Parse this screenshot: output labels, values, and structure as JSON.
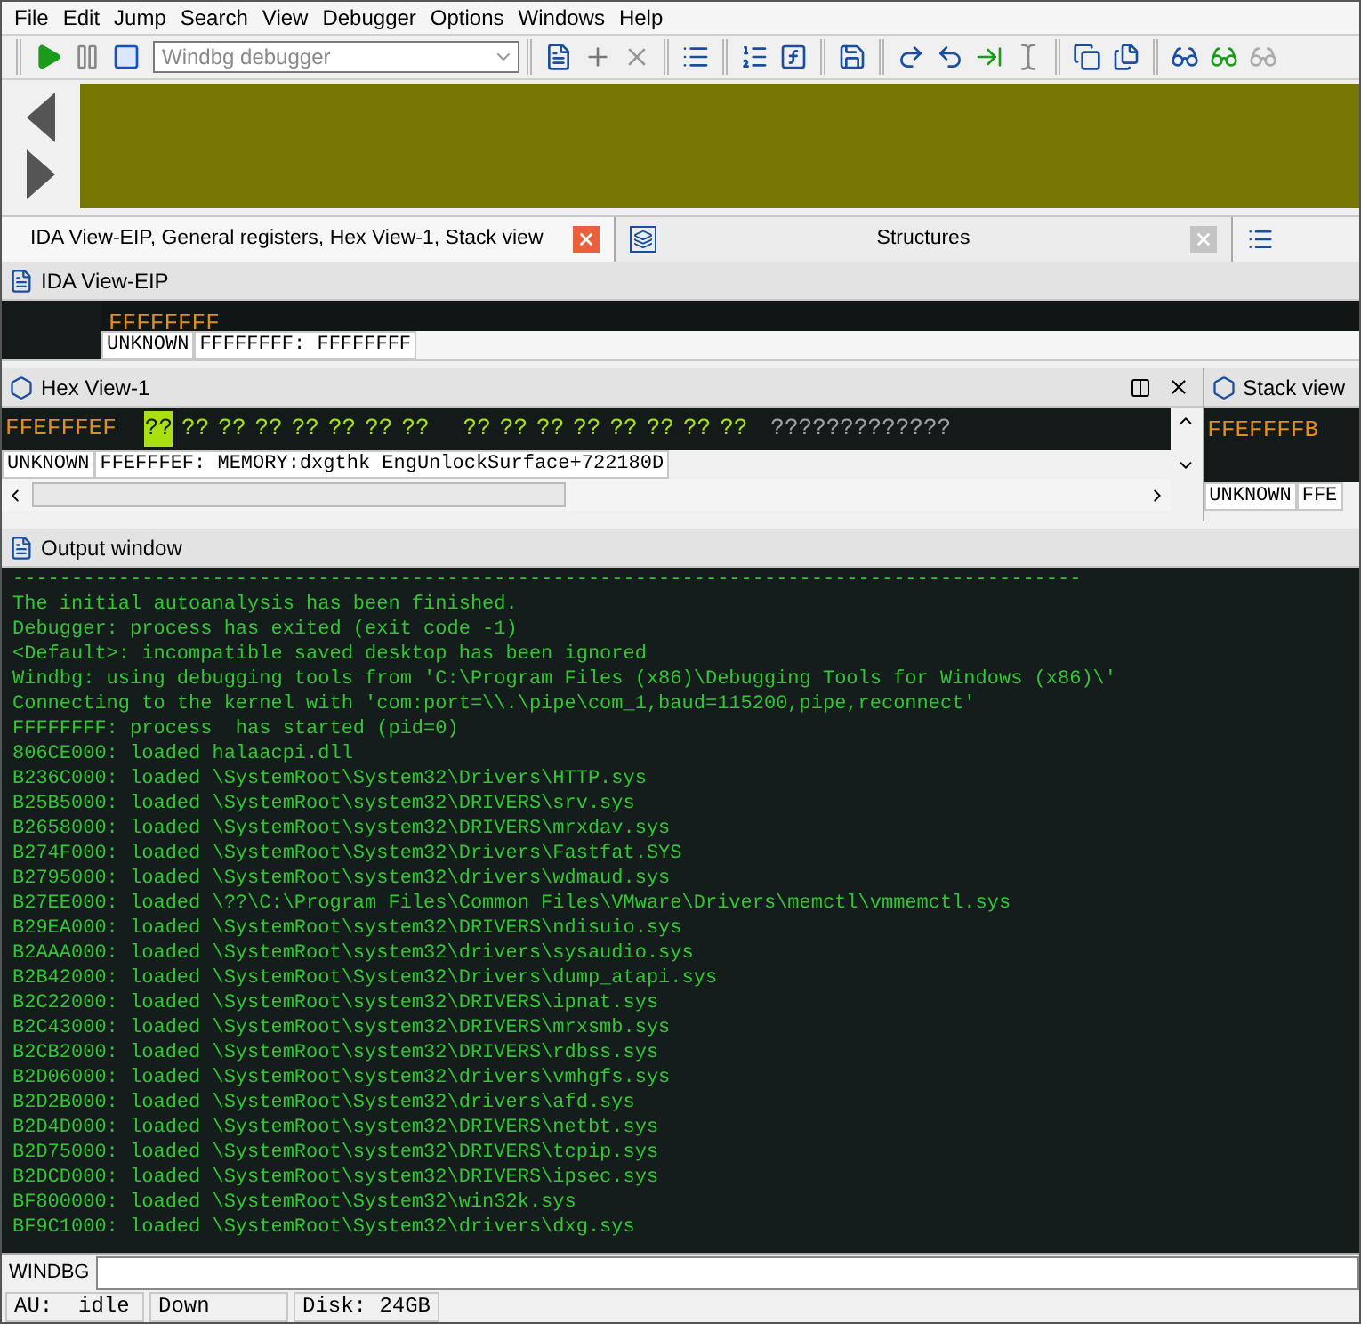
{
  "menu": [
    {
      "label": "File"
    },
    {
      "label": "Edit"
    },
    {
      "label": "Jump"
    },
    {
      "label": "Search"
    },
    {
      "label": "View"
    },
    {
      "label": "Debugger"
    },
    {
      "label": "Options"
    },
    {
      "label": "Windows"
    },
    {
      "label": "Help"
    }
  ],
  "toolbar": {
    "debugger_select": "Windbg debugger",
    "groups": [
      {
        "buttons": [
          {
            "kind": "play"
          },
          {
            "kind": "pause"
          },
          {
            "kind": "stop"
          }
        ],
        "has_select": true
      },
      {
        "buttons": [
          {
            "kind": "breakpoints"
          },
          {
            "kind": "bp-add"
          },
          {
            "kind": "bp-remove"
          }
        ]
      },
      {
        "buttons": [
          {
            "kind": "step-list"
          }
        ]
      },
      {
        "buttons": [
          {
            "kind": "trace-list"
          },
          {
            "kind": "trace-func"
          }
        ]
      },
      {
        "buttons": [
          {
            "kind": "trace-save"
          }
        ]
      },
      {
        "buttons": [
          {
            "kind": "step-into"
          },
          {
            "kind": "step-over"
          },
          {
            "kind": "run-to"
          },
          {
            "kind": "run-cursor"
          }
        ]
      },
      {
        "buttons": [
          {
            "kind": "windows"
          },
          {
            "kind": "copy-window"
          }
        ]
      },
      {
        "buttons": [
          {
            "kind": "watch"
          },
          {
            "kind": "watch-add"
          },
          {
            "kind": "watch-remove"
          }
        ]
      }
    ]
  },
  "tabs": [
    {
      "label": "IDA View-EIP, General registers, Hex View-1, Stack view",
      "selected": true,
      "kind": "text"
    },
    {
      "label": "Structures",
      "selected": false,
      "kind": "text"
    },
    {
      "selected": false,
      "kind": "icon"
    }
  ],
  "ida_view": {
    "title": "IDA View-EIP",
    "address": "FFFFFFFF",
    "status": [
      "UNKNOWN",
      "FFFFFFFF: FFFFFFFF"
    ]
  },
  "hex_view": {
    "title": "Hex View-1",
    "address": "FFEFFFEF",
    "bytes": [
      {
        "text": "??",
        "selected": true
      },
      {
        "text": "??",
        "selected": false
      },
      {
        "text": "??",
        "selected": false
      },
      {
        "text": "??",
        "selected": false
      },
      {
        "text": "??",
        "selected": false
      },
      {
        "text": "??",
        "selected": false
      },
      {
        "text": "??",
        "selected": false
      },
      {
        "text": "??",
        "selected": false
      },
      {
        "text": "??",
        "selected": false
      },
      {
        "text": "??",
        "selected": false
      },
      {
        "text": "??",
        "selected": false
      },
      {
        "text": "??",
        "selected": false
      },
      {
        "text": "??",
        "selected": false
      },
      {
        "text": "??",
        "selected": false
      },
      {
        "text": "??",
        "selected": false
      },
      {
        "text": "??",
        "selected": false
      }
    ],
    "ascii": "?????????????",
    "status": [
      "UNKNOWN",
      "FFEFFFEF: MEMORY:dxgthk EngUnlockSurface+722180D"
    ]
  },
  "stack_view": {
    "title": "Stack view",
    "address": "FFEFFFFB",
    "status": [
      "UNKNOWN",
      "FFE"
    ]
  },
  "output": {
    "title": "Output window",
    "lines": [
      "-------------------------------------------------------------------------------------------",
      "The initial autoanalysis has been finished.",
      "Debugger: process has exited (exit code -1)",
      "<Default>: incompatible saved desktop has been ignored",
      "Windbg: using debugging tools from 'C:\\Program Files (x86)\\Debugging Tools for Windows (x86)\\'",
      "Connecting to the kernel with 'com:port=\\\\.\\pipe\\com_1,baud=115200,pipe,reconnect'",
      "FFFFFFFF: process  has started (pid=0)",
      "806CE000: loaded halaacpi.dll",
      "B236C000: loaded \\SystemRoot\\System32\\Drivers\\HTTP.sys",
      "B25B5000: loaded \\SystemRoot\\system32\\DRIVERS\\srv.sys",
      "B2658000: loaded \\SystemRoot\\system32\\DRIVERS\\mrxdav.sys",
      "B274F000: loaded \\SystemRoot\\System32\\Drivers\\Fastfat.SYS",
      "B2795000: loaded \\SystemRoot\\system32\\drivers\\wdmaud.sys",
      "B27EE000: loaded \\??\\C:\\Program Files\\Common Files\\VMware\\Drivers\\memctl\\vmmemctl.sys",
      "B29EA000: loaded \\SystemRoot\\system32\\DRIVERS\\ndisuio.sys",
      "B2AAA000: loaded \\SystemRoot\\system32\\drivers\\sysaudio.sys",
      "B2B42000: loaded \\SystemRoot\\System32\\Drivers\\dump_atapi.sys",
      "B2C22000: loaded \\SystemRoot\\system32\\DRIVERS\\ipnat.sys",
      "B2C43000: loaded \\SystemRoot\\system32\\DRIVERS\\mrxsmb.sys",
      "B2CB2000: loaded \\SystemRoot\\system32\\DRIVERS\\rdbss.sys",
      "B2D06000: loaded \\SystemRoot\\system32\\drivers\\vmhgfs.sys",
      "B2D2B000: loaded \\SystemRoot\\System32\\drivers\\afd.sys",
      "B2D4D000: loaded \\SystemRoot\\system32\\DRIVERS\\netbt.sys",
      "B2D75000: loaded \\SystemRoot\\system32\\DRIVERS\\tcpip.sys",
      "B2DCD000: loaded \\SystemRoot\\system32\\DRIVERS\\ipsec.sys",
      "BF800000: loaded \\SystemRoot\\System32\\win32k.sys",
      "BF9C1000: loaded \\SystemRoot\\System32\\drivers\\dxg.sys"
    ]
  },
  "command": {
    "label": "WINDBG"
  },
  "status_bar": [
    "AU:  idle",
    "Down",
    "Disk: 24GB"
  ]
}
